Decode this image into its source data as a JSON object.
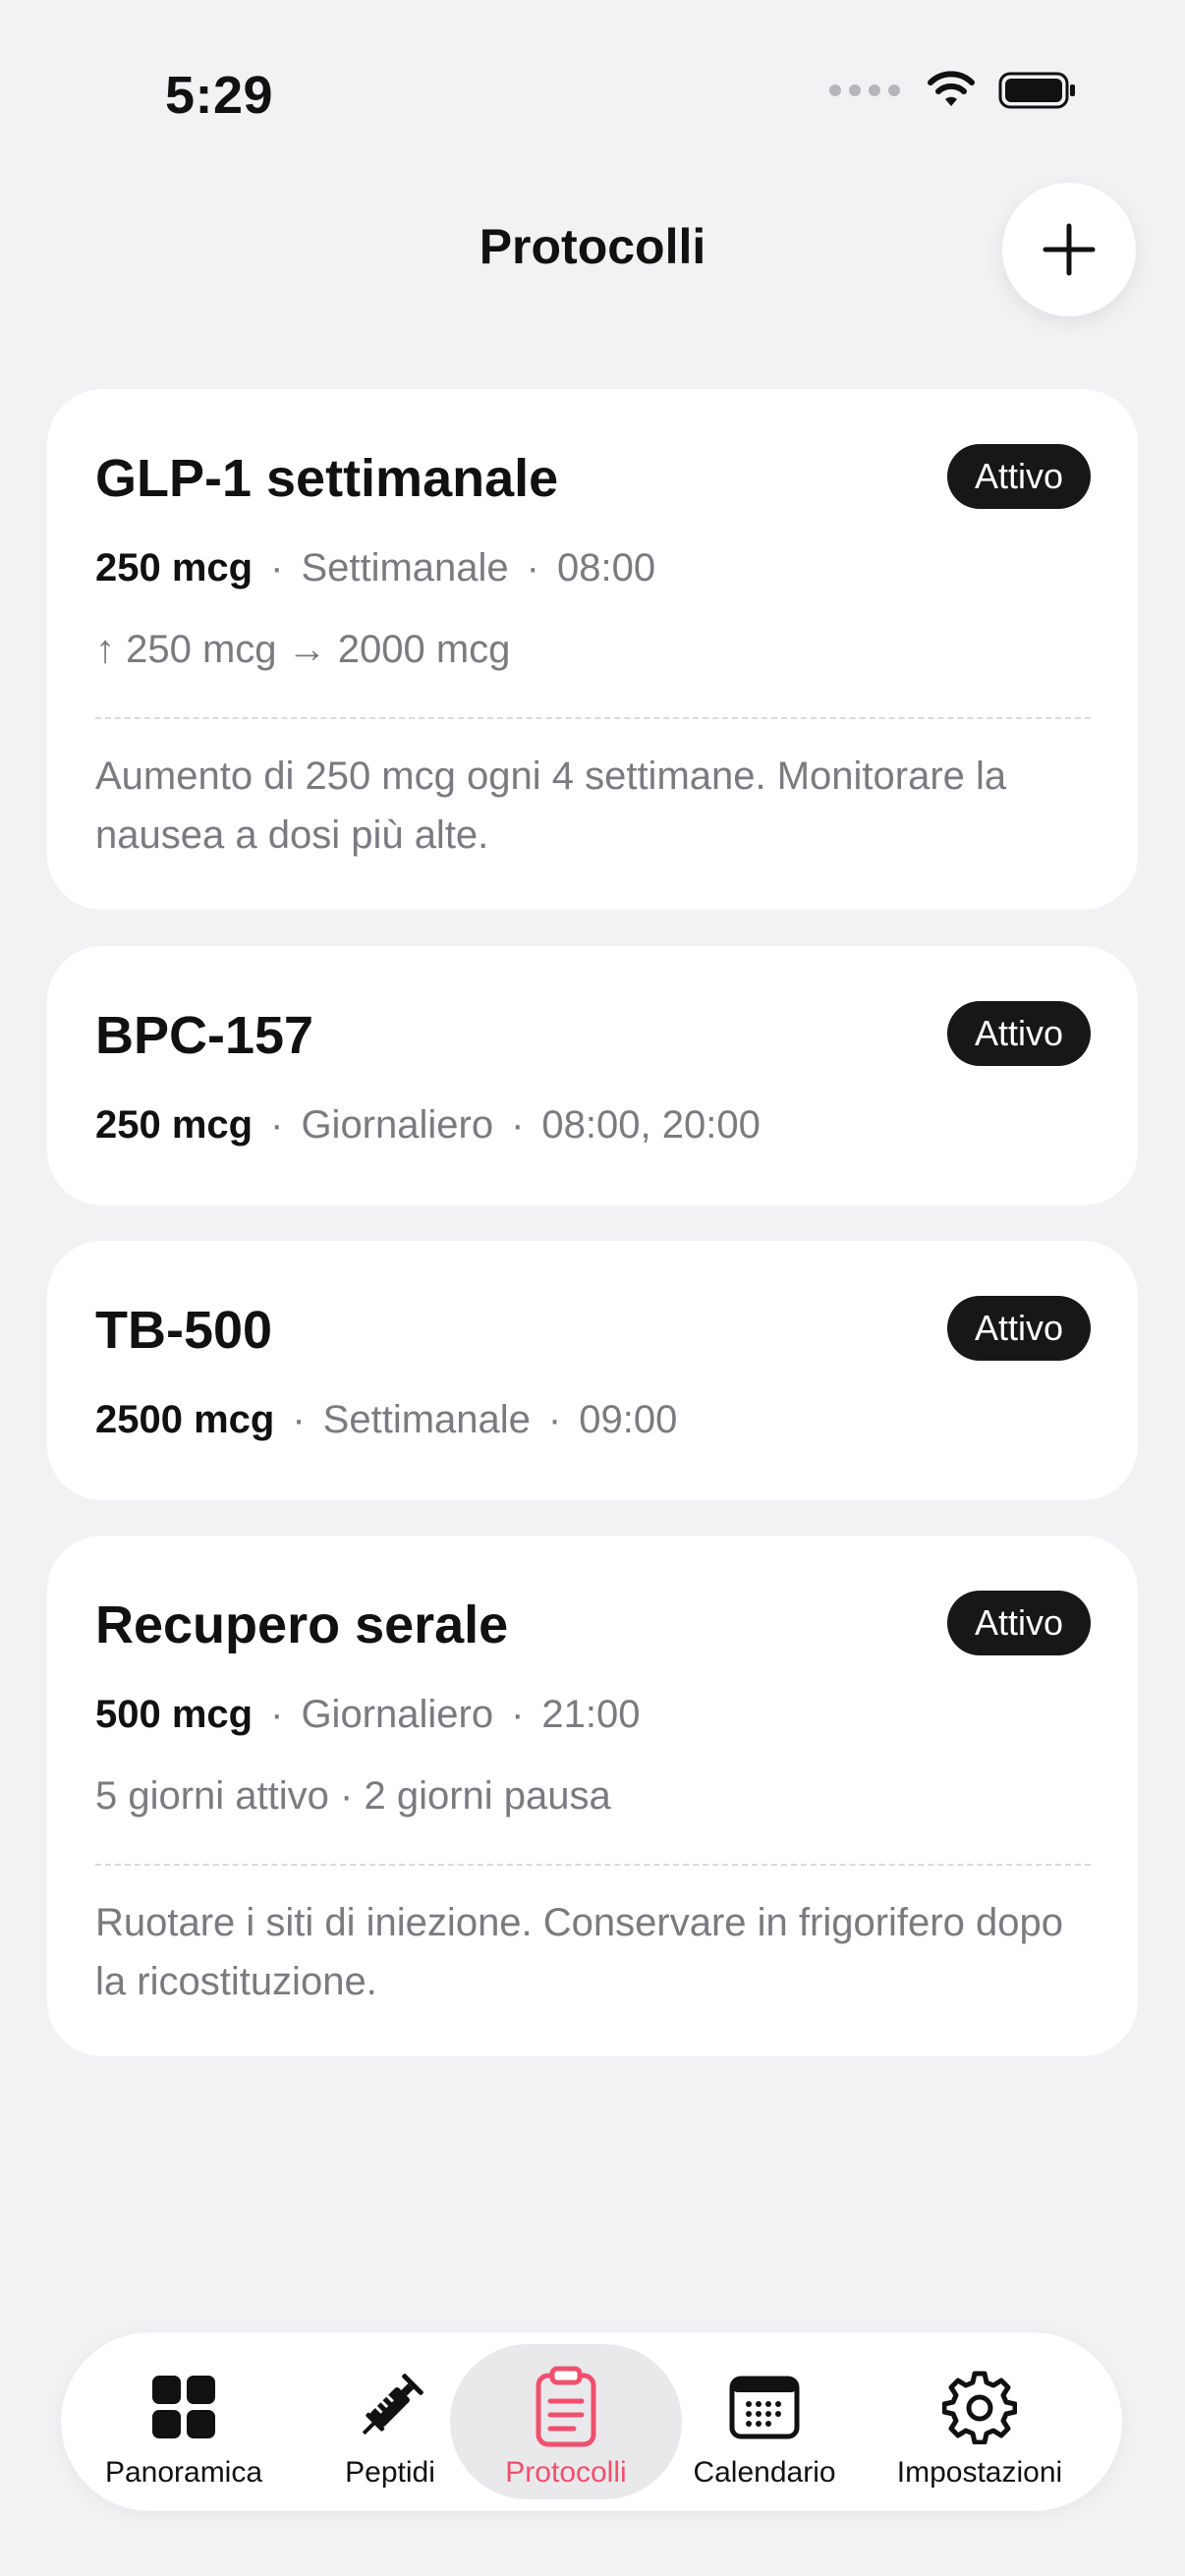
{
  "status_bar": {
    "time": "5:29"
  },
  "header": {
    "title": "Protocolli",
    "add_icon": "plus-icon"
  },
  "protocols": [
    {
      "name": "GLP-1 settimanale",
      "status": "Attivo",
      "dose": "250 mcg",
      "frequency": "Settimanale",
      "times": "08:00",
      "extra": "↑ 250 mcg → 2000 mcg",
      "notes": "Aumento di 250 mcg ogni 4 settimane. Monitorare la nausea a dosi più alte."
    },
    {
      "name": "BPC-157",
      "status": "Attivo",
      "dose": "250 mcg",
      "frequency": "Giornaliero",
      "times": "08:00, 20:00"
    },
    {
      "name": "TB-500",
      "status": "Attivo",
      "dose": "2500 mcg",
      "frequency": "Settimanale",
      "times": "09:00"
    },
    {
      "name": "Recupero serale",
      "status": "Attivo",
      "dose": "500 mcg",
      "frequency": "Giornaliero",
      "times": "21:00",
      "extra": "5 giorni attivo · 2 giorni pausa",
      "notes": "Ruotare i siti di iniezione. Conservare in frigorifero dopo la ricostituzione."
    }
  ],
  "separator": "·",
  "tabbar": {
    "items": [
      {
        "label": "Panoramica",
        "icon": "grid-icon"
      },
      {
        "label": "Peptidi",
        "icon": "syringe-icon"
      },
      {
        "label": "Protocolli",
        "icon": "clipboard-icon",
        "active": true
      },
      {
        "label": "Calendario",
        "icon": "calendar-icon"
      },
      {
        "label": "Impostazioni",
        "icon": "gear-icon"
      }
    ]
  },
  "colors": {
    "accent": "#f0506e",
    "badge_bg": "#171717",
    "background": "#f2f2f5"
  }
}
